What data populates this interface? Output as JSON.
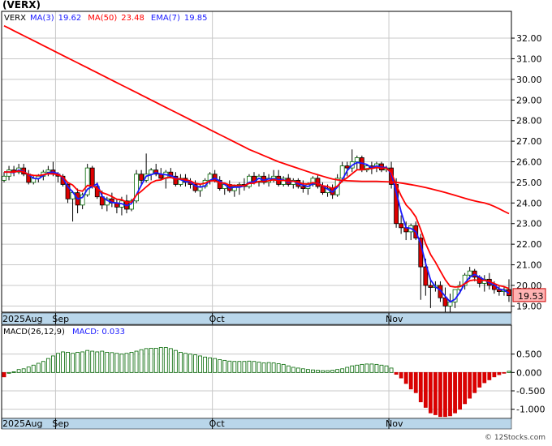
{
  "chart_data": [
    {
      "type": "candlestick",
      "title": "(VERX)",
      "legend": [
        {
          "label": "VERX",
          "value": "",
          "color": "#000000"
        },
        {
          "label": "MA(3)",
          "value": "19.62",
          "color": "#1a1aff"
        },
        {
          "label": "MA(50)",
          "value": "23.48",
          "color": "#ff0000"
        },
        {
          "label": "EMA(7)",
          "value": "19.85",
          "color": "#1a1aff"
        }
      ],
      "ylim": [
        18.7,
        33.3
      ],
      "yticks": [
        "19.00",
        "20.00",
        "21.00",
        "22.00",
        "23.00",
        "24.00",
        "25.00",
        "26.00",
        "27.00",
        "28.00",
        "29.00",
        "30.00",
        "31.00",
        "32.00"
      ],
      "last_price": "19.53",
      "x_labels": [
        {
          "label": "2025Aug",
          "index": 0
        },
        {
          "label": "Sep",
          "index": 11
        },
        {
          "label": "Oct",
          "index": 43
        },
        {
          "label": "Nov",
          "index": 79
        }
      ],
      "candles": [
        [
          25.1,
          25.5,
          25.0,
          25.3
        ],
        [
          25.3,
          25.8,
          25.1,
          25.6
        ],
        [
          25.6,
          25.8,
          25.3,
          25.5
        ],
        [
          25.5,
          25.9,
          25.4,
          25.7
        ],
        [
          25.7,
          25.9,
          25.3,
          25.4
        ],
        [
          25.4,
          25.6,
          24.9,
          25.0
        ],
        [
          25.0,
          25.3,
          24.9,
          25.2
        ],
        [
          25.2,
          25.4,
          25.0,
          25.3
        ],
        [
          25.3,
          25.6,
          25.1,
          25.5
        ],
        [
          25.5,
          25.8,
          25.3,
          25.6
        ],
        [
          25.6,
          26.0,
          25.3,
          25.4
        ],
        [
          25.4,
          25.5,
          25.0,
          25.3
        ],
        [
          25.3,
          25.4,
          24.8,
          24.9
        ],
        [
          24.9,
          25.0,
          24.0,
          24.2
        ],
        [
          24.2,
          24.6,
          23.1,
          24.5
        ],
        [
          24.5,
          24.7,
          23.5,
          23.9
        ],
        [
          23.9,
          24.5,
          23.7,
          24.4
        ],
        [
          24.4,
          25.9,
          24.3,
          25.7
        ],
        [
          25.7,
          25.8,
          24.7,
          24.8
        ],
        [
          24.8,
          25.0,
          24.2,
          24.3
        ],
        [
          24.3,
          24.6,
          23.7,
          23.9
        ],
        [
          23.9,
          24.3,
          23.6,
          24.2
        ],
        [
          24.2,
          24.5,
          23.8,
          24.0
        ],
        [
          24.0,
          24.2,
          23.5,
          23.8
        ],
        [
          23.8,
          24.3,
          23.4,
          24.1
        ],
        [
          24.1,
          24.4,
          23.5,
          23.7
        ],
        [
          23.7,
          24.2,
          23.6,
          24.1
        ],
        [
          24.1,
          25.6,
          24.0,
          25.4
        ],
        [
          25.4,
          25.6,
          24.9,
          25.1
        ],
        [
          25.1,
          26.4,
          25.0,
          25.4
        ],
        [
          25.4,
          25.7,
          25.1,
          25.6
        ],
        [
          25.6,
          25.9,
          25.3,
          25.4
        ],
        [
          25.4,
          25.7,
          25.1,
          25.2
        ],
        [
          25.2,
          25.6,
          24.7,
          25.5
        ],
        [
          25.5,
          25.7,
          25.2,
          25.3
        ],
        [
          25.3,
          25.5,
          24.8,
          24.9
        ],
        [
          24.9,
          25.4,
          24.8,
          25.2
        ],
        [
          25.2,
          25.4,
          24.8,
          25.0
        ],
        [
          25.0,
          25.2,
          24.7,
          24.9
        ],
        [
          24.9,
          25.1,
          24.5,
          24.6
        ],
        [
          24.6,
          24.9,
          24.3,
          24.8
        ],
        [
          24.8,
          25.2,
          24.7,
          25.1
        ],
        [
          25.1,
          25.5,
          24.9,
          25.4
        ],
        [
          25.4,
          25.6,
          25.0,
          25.1
        ],
        [
          25.1,
          25.3,
          24.6,
          24.7
        ],
        [
          24.7,
          25.0,
          24.4,
          24.9
        ],
        [
          24.9,
          25.1,
          24.5,
          24.6
        ],
        [
          24.6,
          24.9,
          24.3,
          24.8
        ],
        [
          24.8,
          25.0,
          24.4,
          24.9
        ],
        [
          24.9,
          25.2,
          24.6,
          24.8
        ],
        [
          24.8,
          25.4,
          24.7,
          25.3
        ],
        [
          25.3,
          25.5,
          24.9,
          25.0
        ],
        [
          25.0,
          25.4,
          24.8,
          25.3
        ],
        [
          25.3,
          25.5,
          24.9,
          25.0
        ],
        [
          25.0,
          25.4,
          24.8,
          25.2
        ],
        [
          25.2,
          25.6,
          25.0,
          25.3
        ],
        [
          25.3,
          25.6,
          24.8,
          24.9
        ],
        [
          24.9,
          25.3,
          24.8,
          25.2
        ],
        [
          25.2,
          25.4,
          24.8,
          24.9
        ],
        [
          24.9,
          25.2,
          24.7,
          25.1
        ],
        [
          25.1,
          25.2,
          24.7,
          24.8
        ],
        [
          24.8,
          25.1,
          24.5,
          24.7
        ],
        [
          24.7,
          25.0,
          24.4,
          24.9
        ],
        [
          24.9,
          25.3,
          24.8,
          25.2
        ],
        [
          25.2,
          25.4,
          24.7,
          24.8
        ],
        [
          24.8,
          25.0,
          24.4,
          24.5
        ],
        [
          24.5,
          24.9,
          24.3,
          24.7
        ],
        [
          24.7,
          24.9,
          24.2,
          24.4
        ],
        [
          24.4,
          25.4,
          24.3,
          25.2
        ],
        [
          25.2,
          26.0,
          25.0,
          25.8
        ],
        [
          25.8,
          26.0,
          25.3,
          25.7
        ],
        [
          25.7,
          26.6,
          25.5,
          26.0
        ],
        [
          26.0,
          26.3,
          25.6,
          26.2
        ],
        [
          26.2,
          26.3,
          25.5,
          25.6
        ],
        [
          25.6,
          25.9,
          25.5,
          25.8
        ],
        [
          25.8,
          26.0,
          25.4,
          25.7
        ],
        [
          25.7,
          26.0,
          25.5,
          25.9
        ],
        [
          25.9,
          26.0,
          25.5,
          25.6
        ],
        [
          25.6,
          25.8,
          25.5,
          25.7
        ],
        [
          25.7,
          26.0,
          24.7,
          24.9
        ],
        [
          24.9,
          25.2,
          22.8,
          23.0
        ],
        [
          23.0,
          23.4,
          22.5,
          22.8
        ],
        [
          22.8,
          23.1,
          22.2,
          22.6
        ],
        [
          22.6,
          23.0,
          22.2,
          22.9
        ],
        [
          22.9,
          23.1,
          22.2,
          22.3
        ],
        [
          22.3,
          22.5,
          19.3,
          20.9
        ],
        [
          20.9,
          21.3,
          19.5,
          20.0
        ],
        [
          20.0,
          20.3,
          18.9,
          19.9
        ],
        [
          19.9,
          20.2,
          19.7,
          20.0
        ],
        [
          20.0,
          20.2,
          19.2,
          19.4
        ],
        [
          19.4,
          19.9,
          18.7,
          19.0
        ],
        [
          19.0,
          19.6,
          18.7,
          19.2
        ],
        [
          19.2,
          19.6,
          18.9,
          19.8
        ],
        [
          19.8,
          20.2,
          19.6,
          20.0
        ],
        [
          20.0,
          20.6,
          19.8,
          20.5
        ],
        [
          20.5,
          20.9,
          20.3,
          20.7
        ],
        [
          20.7,
          20.8,
          20.2,
          20.4
        ],
        [
          20.4,
          20.5,
          19.9,
          20.1
        ],
        [
          20.1,
          20.5,
          19.7,
          20.3
        ],
        [
          20.3,
          20.6,
          19.8,
          20.0
        ],
        [
          20.0,
          20.2,
          19.6,
          19.8
        ],
        [
          19.8,
          20.0,
          19.5,
          19.7
        ],
        [
          19.7,
          19.9,
          19.5,
          19.8
        ],
        [
          19.8,
          20.3,
          19.2,
          19.5
        ]
      ],
      "series": [
        {
          "name": "MA(3)",
          "color": "#1a1aff",
          "values": [
            25.5,
            25.5,
            25.47,
            25.6,
            25.53,
            25.37,
            25.2,
            25.17,
            25.33,
            25.47,
            25.5,
            25.43,
            25.2,
            24.8,
            24.53,
            24.2,
            24.27,
            24.67,
            24.8,
            24.93,
            24.33,
            24.13,
            24.03,
            24.0,
            23.97,
            23.87,
            23.97,
            24.4,
            24.87,
            25.3,
            25.37,
            25.47,
            25.4,
            25.37,
            25.33,
            25.23,
            25.13,
            25.03,
            25.03,
            24.83,
            24.77,
            24.83,
            25.1,
            25.2,
            25.07,
            24.9,
            24.73,
            24.77,
            24.77,
            24.83,
            25.0,
            25.03,
            25.2,
            25.1,
            25.17,
            25.17,
            25.13,
            25.13,
            25.0,
            25.07,
            24.93,
            24.87,
            24.8,
            24.93,
            24.97,
            24.83,
            24.67,
            24.53,
            24.77,
            25.13,
            25.57,
            25.83,
            25.97,
            25.93,
            25.87,
            25.7,
            25.8,
            25.73,
            25.73,
            25.4,
            24.53,
            23.57,
            22.8,
            22.77,
            22.6,
            22.03,
            21.07,
            20.27,
            19.93,
            19.77,
            19.47,
            19.2,
            19.33,
            19.67,
            20.1,
            20.4,
            20.53,
            20.4,
            20.27,
            20.13,
            20.03,
            19.83,
            19.77,
            19.62
          ]
        },
        {
          "name": "EMA(7)",
          "color": "#ff0000",
          "values": [
            25.5,
            25.5,
            25.5,
            25.55,
            25.51,
            25.38,
            25.34,
            25.33,
            25.37,
            25.42,
            25.41,
            25.38,
            25.26,
            24.99,
            24.87,
            24.62,
            24.57,
            24.85,
            24.84,
            24.7,
            24.5,
            24.42,
            24.31,
            24.18,
            24.16,
            24.04,
            24.05,
            24.39,
            24.57,
            24.78,
            24.98,
            25.09,
            25.12,
            25.22,
            25.24,
            25.16,
            25.17,
            25.13,
            25.07,
            24.95,
            24.91,
            24.96,
            25.07,
            25.08,
            24.98,
            24.96,
            24.87,
            24.85,
            24.86,
            24.84,
            24.95,
            24.96,
            25.05,
            25.04,
            25.08,
            25.13,
            25.07,
            25.1,
            25.05,
            25.06,
            25.0,
            24.93,
            24.92,
            24.99,
            24.94,
            24.83,
            24.8,
            24.7,
            24.82,
            25.07,
            25.23,
            25.42,
            25.61,
            25.61,
            25.66,
            25.67,
            25.72,
            25.69,
            25.69,
            25.49,
            24.87,
            24.35,
            23.91,
            23.66,
            23.32,
            22.71,
            22.03,
            21.5,
            21.13,
            20.7,
            20.28,
            19.96,
            19.92,
            19.94,
            20.08,
            20.23,
            20.27,
            20.23,
            20.25,
            20.19,
            20.09,
            19.99,
            19.94,
            19.85
          ]
        },
        {
          "name": "MA(50)",
          "color": "#ff0000",
          "values": [
            32.6,
            32.48,
            32.36,
            32.24,
            32.12,
            32.0,
            31.88,
            31.76,
            31.64,
            31.52,
            31.4,
            31.28,
            31.16,
            31.04,
            30.92,
            30.8,
            30.68,
            30.56,
            30.44,
            30.32,
            30.2,
            30.08,
            29.96,
            29.84,
            29.72,
            29.6,
            29.48,
            29.36,
            29.24,
            29.12,
            29.0,
            28.88,
            28.76,
            28.64,
            28.52,
            28.4,
            28.28,
            28.16,
            28.04,
            27.92,
            27.8,
            27.68,
            27.56,
            27.44,
            27.32,
            27.2,
            27.08,
            26.96,
            26.84,
            26.72,
            26.6,
            26.5,
            26.4,
            26.3,
            26.2,
            26.1,
            26.0,
            25.92,
            25.84,
            25.76,
            25.68,
            25.6,
            25.52,
            25.44,
            25.37,
            25.3,
            25.23,
            25.16,
            25.12,
            25.1,
            25.08,
            25.07,
            25.06,
            25.05,
            25.05,
            25.05,
            25.05,
            25.04,
            25.03,
            25.02,
            25.0,
            24.97,
            24.93,
            24.89,
            24.85,
            24.8,
            24.75,
            24.69,
            24.63,
            24.57,
            24.51,
            24.44,
            24.37,
            24.3,
            24.23,
            24.16,
            24.1,
            24.05,
            24.0,
            23.93,
            23.83,
            23.72,
            23.6,
            23.48
          ]
        }
      ]
    },
    {
      "type": "bar",
      "title": "MACD(26,12,9)",
      "legend": [
        {
          "label": "MACD(26,12,9)",
          "value": "",
          "color": "#000000"
        },
        {
          "label": "MACD:",
          "value": "0.033",
          "color": "#1a1aff"
        }
      ],
      "ylim": [
        -1.25,
        1.0
      ],
      "yticks": [
        "0.500",
        "0.000",
        "-0.500",
        "-1.000"
      ],
      "x_labels": [
        {
          "label": "2025Aug",
          "index": 0
        },
        {
          "label": "Sep",
          "index": 11
        },
        {
          "label": "Oct",
          "index": 43
        },
        {
          "label": "Nov",
          "index": 79
        }
      ],
      "values": [
        -0.12,
        0.0,
        0.02,
        0.08,
        0.1,
        0.15,
        0.2,
        0.25,
        0.3,
        0.38,
        0.45,
        0.52,
        0.56,
        0.55,
        0.52,
        0.55,
        0.56,
        0.6,
        0.58,
        0.56,
        0.58,
        0.55,
        0.54,
        0.52,
        0.5,
        0.52,
        0.55,
        0.58,
        0.62,
        0.65,
        0.66,
        0.66,
        0.68,
        0.68,
        0.65,
        0.6,
        0.55,
        0.52,
        0.5,
        0.48,
        0.45,
        0.42,
        0.4,
        0.38,
        0.35,
        0.33,
        0.31,
        0.3,
        0.3,
        0.3,
        0.31,
        0.3,
        0.28,
        0.26,
        0.27,
        0.26,
        0.24,
        0.22,
        0.18,
        0.14,
        0.12,
        0.1,
        0.08,
        0.07,
        0.06,
        0.05,
        0.05,
        0.06,
        0.08,
        0.1,
        0.14,
        0.18,
        0.2,
        0.22,
        0.23,
        0.23,
        0.22,
        0.2,
        0.18,
        0.12,
        -0.05,
        -0.15,
        -0.3,
        -0.45,
        -0.55,
        -0.8,
        -0.95,
        -1.1,
        -1.15,
        -1.2,
        -1.2,
        -1.18,
        -1.1,
        -1.0,
        -0.85,
        -0.7,
        -0.55,
        -0.4,
        -0.28,
        -0.2,
        -0.12,
        -0.06,
        -0.02,
        0.033
      ]
    }
  ]
}
